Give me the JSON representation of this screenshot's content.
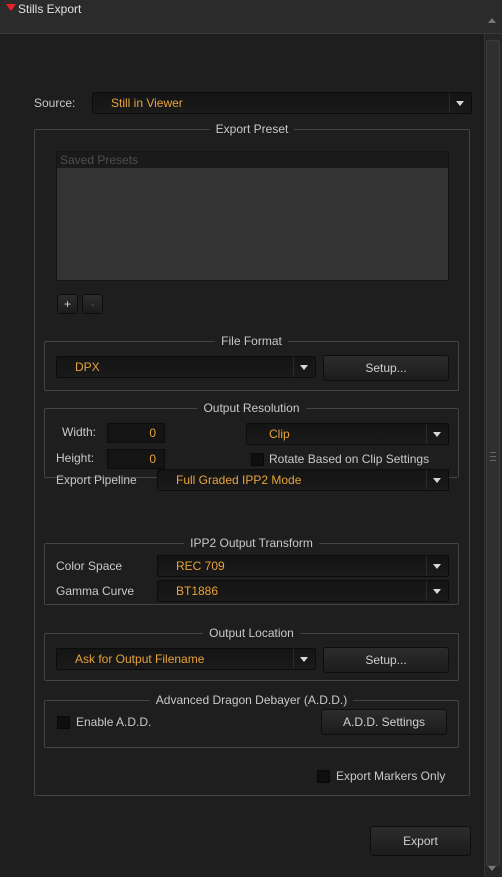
{
  "panel": {
    "title": "Stills Export"
  },
  "source": {
    "label": "Source:",
    "value": "Still in Viewer"
  },
  "export_preset": {
    "legend": "Export Preset",
    "list_header": "Saved Presets",
    "add_label": "+",
    "remove_label": "-"
  },
  "file_format": {
    "legend": "File Format",
    "value": "DPX",
    "setup_label": "Setup..."
  },
  "output_resolution": {
    "legend": "Output Resolution",
    "width_label": "Width:",
    "width_value": "0",
    "height_label": "Height:",
    "height_value": "0",
    "mode_value": "Clip",
    "rotate_label": "Rotate Based on Clip Settings"
  },
  "export_pipeline": {
    "label": "Export Pipeline",
    "value": "Full Graded IPP2 Mode"
  },
  "ipp2": {
    "legend": "IPP2 Output Transform",
    "color_space_label": "Color Space",
    "color_space_value": "REC 709",
    "gamma_label": "Gamma Curve",
    "gamma_value": "BT1886"
  },
  "output_location": {
    "legend": "Output Location",
    "value": "Ask for Output Filename",
    "setup_label": "Setup..."
  },
  "add": {
    "legend": "Advanced Dragon Debayer (A.D.D.)",
    "enable_label": "Enable A.D.D.",
    "settings_label": "A.D.D. Settings"
  },
  "markers_only_label": "Export Markers Only",
  "export_label": "Export",
  "colors": {
    "accent_text": "#e8a33a",
    "collapse_arrow": "#e8202a",
    "background": "#1e1e1e"
  }
}
